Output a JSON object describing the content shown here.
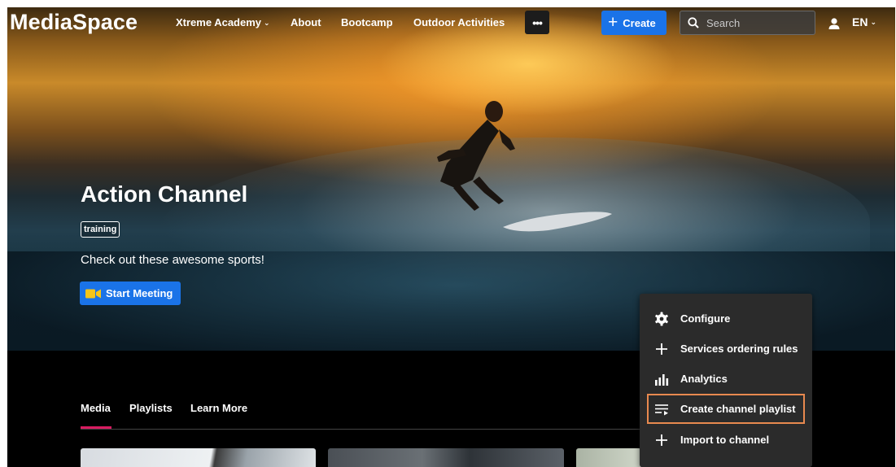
{
  "header": {
    "logo": "MediaSpace",
    "nav": [
      {
        "label": "Xtreme Academy",
        "has_dropdown": true
      },
      {
        "label": "About",
        "has_dropdown": false
      },
      {
        "label": "Bootcamp",
        "has_dropdown": false
      },
      {
        "label": "Outdoor Activities",
        "has_dropdown": false
      }
    ],
    "more_label": "•••",
    "create_label": "Create",
    "search_placeholder": "Search",
    "language": "EN"
  },
  "channel": {
    "title": "Action Channel",
    "tag": "training",
    "description": "Check out these awesome sports!",
    "start_meeting_label": "Start Meeting"
  },
  "tabs": [
    {
      "label": "Media",
      "active": true
    },
    {
      "label": "Playlists",
      "active": false
    },
    {
      "label": "Learn More",
      "active": false
    }
  ],
  "actions_menu": {
    "items": [
      {
        "label": "Configure",
        "icon": "gear-icon"
      },
      {
        "label": "Services ordering rules",
        "icon": "plus-icon"
      },
      {
        "label": "Analytics",
        "icon": "bar-chart-icon"
      },
      {
        "label": "Create channel playlist",
        "icon": "playlist-add-icon",
        "highlighted": true
      },
      {
        "label": "Import to channel",
        "icon": "plus-icon"
      }
    ]
  },
  "colors": {
    "accent": "#1a73e8",
    "tab_indicator": "#d81b60",
    "highlight_outline": "#e8894f",
    "menu_background": "#2b2b2b"
  }
}
